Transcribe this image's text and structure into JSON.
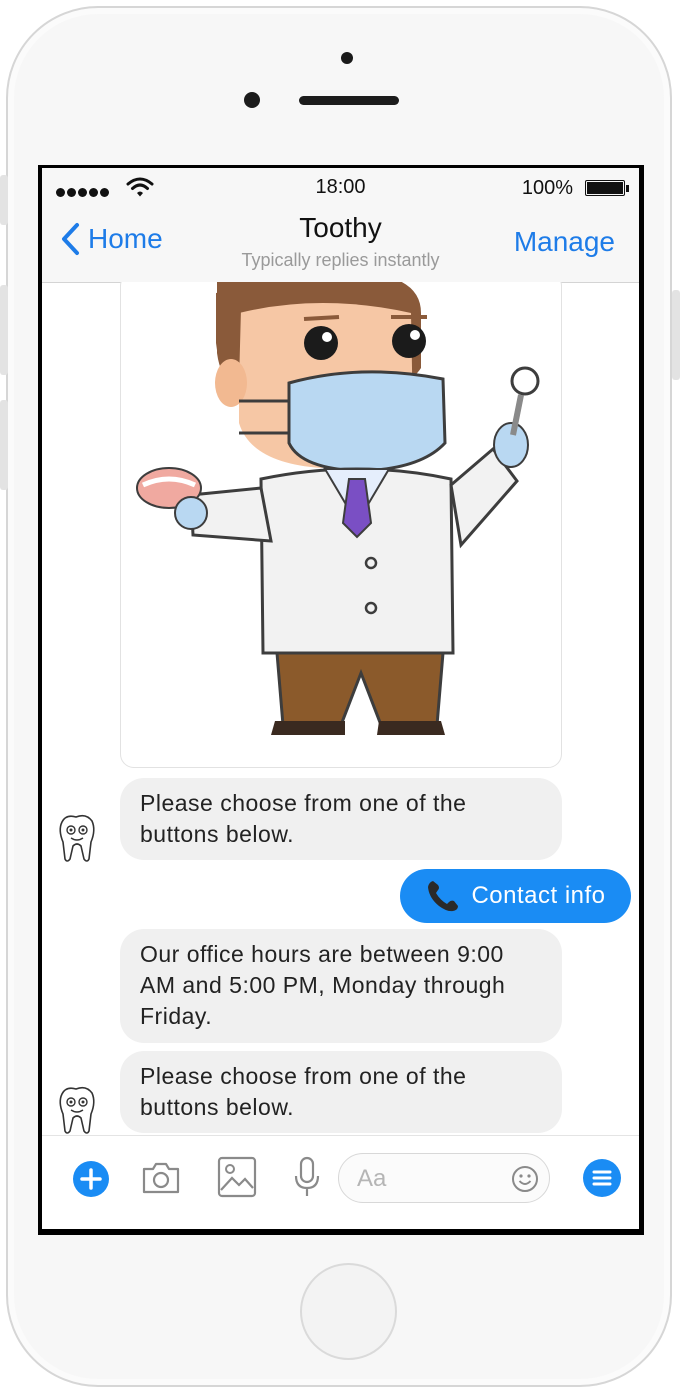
{
  "status_bar": {
    "time": "18:00",
    "battery": "100%"
  },
  "nav": {
    "back_label": "Home",
    "title": "Toothy",
    "subtitle": "Typically replies instantly",
    "manage_label": "Manage"
  },
  "messages": [
    {
      "from": "bot",
      "text": "Please choose from one of the buttons below."
    },
    {
      "from": "user",
      "text": "Contact info",
      "icon": "phone-icon"
    },
    {
      "from": "bot",
      "text": "Our office hours are between 9:00 AM and 5:00 PM, Monday through Friday."
    },
    {
      "from": "bot",
      "text": "Please choose from one of the buttons below."
    }
  ],
  "composer": {
    "placeholder": "Aa",
    "icons": [
      "plus-icon",
      "camera-icon",
      "image-icon",
      "microphone-icon",
      "emoji-icon",
      "menu-icon"
    ]
  },
  "colors": {
    "accent": "#1e7ce8",
    "user_bubble": "#1a8cf4",
    "bot_bubble": "#f0f0f0"
  }
}
